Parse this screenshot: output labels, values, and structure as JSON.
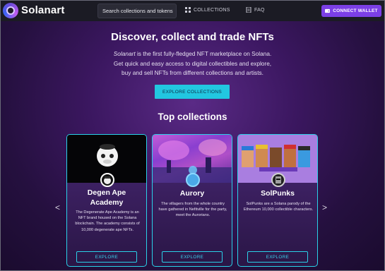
{
  "nav": {
    "brand": "Solanart",
    "search_placeholder": "Search collections and tokens",
    "collections_label": "COLLECTIONS",
    "faq_label": "FAQ",
    "connect_label": "CONNECT WALLET"
  },
  "hero": {
    "headline": "Discover, collect and trade NFTs",
    "desc_brand": "Solanart",
    "desc_line1_rest": " is the first fully-fledged NFT marketplace on Solana.",
    "desc_line2": "Get quick and easy access to digital collectibles and explore,",
    "desc_line3": "buy and sell NFTs from different collections and artists.",
    "cta": "EXPLORE COLLECTIONS"
  },
  "top_collections": {
    "title": "Top collections",
    "prev_arrow": "<",
    "next_arrow": ">",
    "cards": [
      {
        "title_line1": "Degen Ape",
        "title_line2": "Academy",
        "text": "The Degenerate Ape Academy is an NFT brand housed on the Solana blockchain. The academy consists of 10,000 degenerate ape NFTs.",
        "button": "EXPLORE"
      },
      {
        "title_line1": "Aurory",
        "title_line2": "",
        "text": "The villagers from the whole country have gathered in Nefitville for the party, meet the Aurorians.",
        "button": "EXPLORE"
      },
      {
        "title_line1": "SolPunks",
        "title_line2": "",
        "text": "SolPunks are a Solana parody of the Ethereum 10,000 collectible characters.",
        "button": "EXPLORE"
      }
    ]
  },
  "colors": {
    "accent_purple": "#7b3fe6",
    "accent_cyan": "#22c7e0",
    "nav_bg": "#1b1b24"
  }
}
